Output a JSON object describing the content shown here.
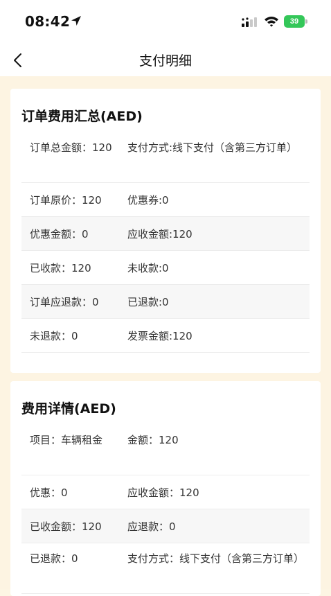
{
  "status_bar": {
    "time": "08:42",
    "battery": "39",
    "icons": [
      "location-arrow-icon",
      "cellular-signal-icon",
      "wifi-icon",
      "battery-charging-icon"
    ]
  },
  "nav": {
    "title": "支付明细",
    "back_icon": "chevron-left-icon"
  },
  "colors": {
    "page_background": "#fdf4e2",
    "card_background": "#ffffff",
    "alt_row": "#f7f7f7",
    "battery": "#34c759"
  },
  "summary": {
    "title": "订单费用汇总(AED)",
    "rows": [
      {
        "left": "订单总金额：120",
        "right": "支付方式:线下支付（含第三方订单）"
      },
      {
        "left": "订单原价：120",
        "right": "优惠券:0"
      },
      {
        "left": "优惠金额：0",
        "right": "应收金额:120"
      },
      {
        "left": "已收款：120",
        "right": "未收款:0"
      },
      {
        "left": "订单应退款：0",
        "right": "已退款:0"
      },
      {
        "left": "未退款：0",
        "right": "发票金额:120"
      }
    ]
  },
  "details": {
    "title": "费用详情(AED)",
    "rows": [
      {
        "left": "项目：车辆租金",
        "right": "金额：120"
      },
      {
        "left": "优惠：0",
        "right": "应收金额：120"
      },
      {
        "left": "已收金额：120",
        "right": "应退款：0"
      },
      {
        "left": "已退款：0",
        "right": "支付方式：线下支付（含第三方订单）"
      }
    ]
  }
}
